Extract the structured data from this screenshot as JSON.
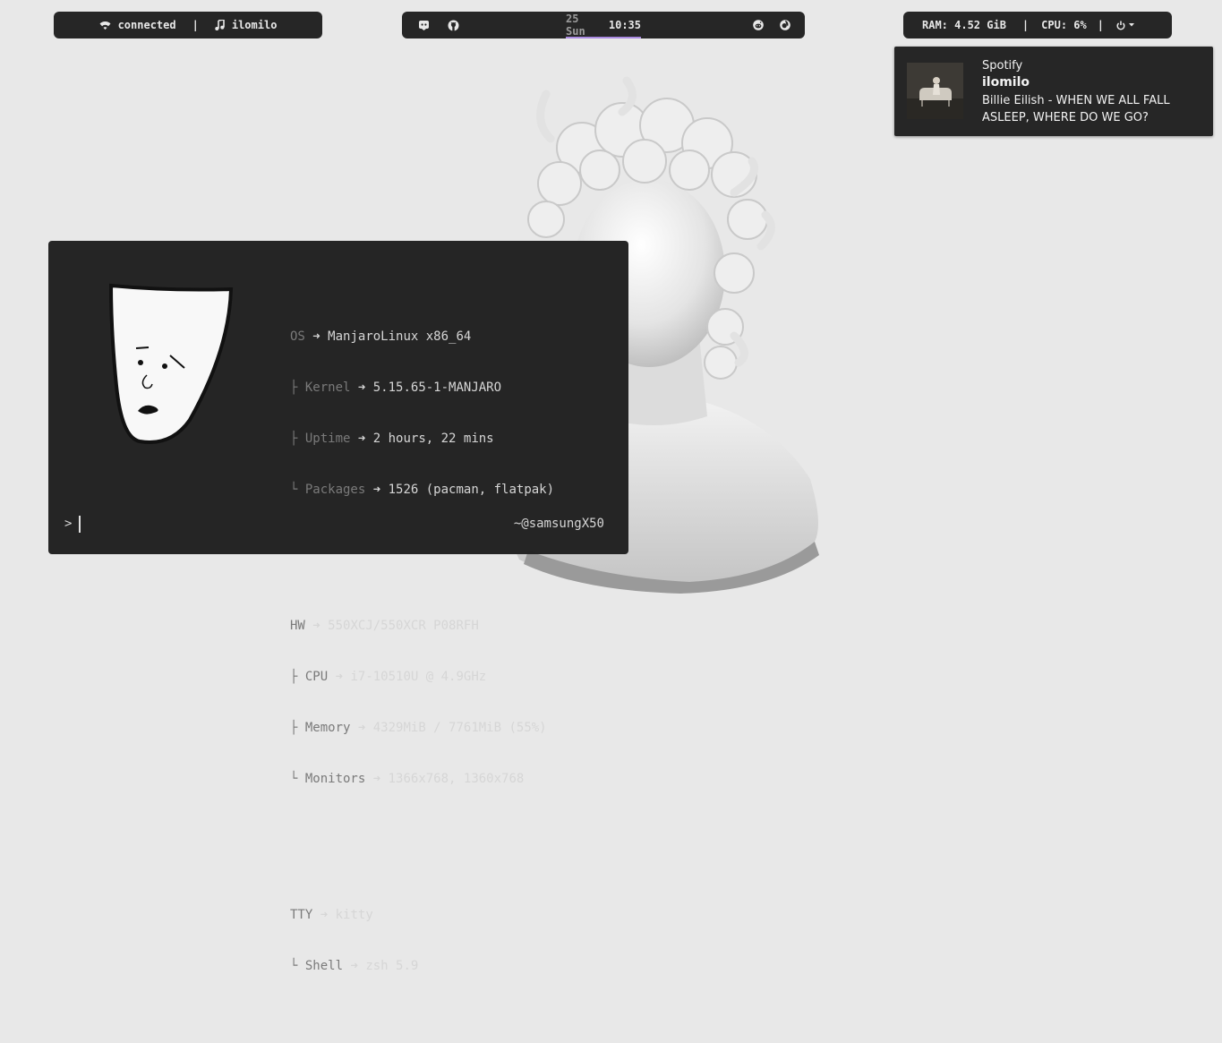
{
  "topbar_left": {
    "wifi_icon": "wifi-icon",
    "network_status": "connected",
    "separator": "|",
    "music_icon": "music-note-icon",
    "now_playing": "ilomilo"
  },
  "topbar_center": {
    "icons": [
      "discord-icon",
      "github-icon",
      "reddit-icon",
      "firefox-icon"
    ],
    "date": "25 Sun",
    "time": "10:35",
    "accent_color": "#a98ae0"
  },
  "topbar_right": {
    "ram": "RAM: 4.52 GiB",
    "sep1": "|",
    "cpu": "CPU: 6%",
    "sep2": "|",
    "power_icon": "power-icon"
  },
  "notification": {
    "app": "Spotify",
    "title": "ilomilo",
    "body": "Billie Eilish - WHEN WE ALL FALL ASLEEP, WHERE DO WE GO?"
  },
  "terminal": {
    "arrow": "➜",
    "os": {
      "key": "OS",
      "value": "ManjaroLinux x86_64"
    },
    "kernel": {
      "prefix": "├ ",
      "key": "Kernel",
      "value": "5.15.65-1-MANJARO"
    },
    "uptime": {
      "prefix": "├ ",
      "key": "Uptime",
      "value": "2 hours, 22 mins"
    },
    "packages": {
      "prefix": "└ ",
      "key": "Packages",
      "value": "1526 (pacman, flatpak)"
    },
    "hw": {
      "key": "HW",
      "value": "550XCJ/550XCR P08RFH"
    },
    "cpu": {
      "prefix": "├ ",
      "key": "CPU",
      "value": "i7-10510U @ 4.9GHz"
    },
    "memory": {
      "prefix": "├ ",
      "key": "Memory",
      "value": "4329MiB / 7761MiB (55%)"
    },
    "monitors": {
      "prefix": "└ ",
      "key": "Monitors",
      "value": "1366x768, 1360x768"
    },
    "tty": {
      "key": "TTY",
      "value": "kitty"
    },
    "shell": {
      "prefix": "└ ",
      "key": "Shell",
      "value": "zsh 5.9"
    },
    "prompt": ">",
    "host": "~@samsungX50"
  }
}
